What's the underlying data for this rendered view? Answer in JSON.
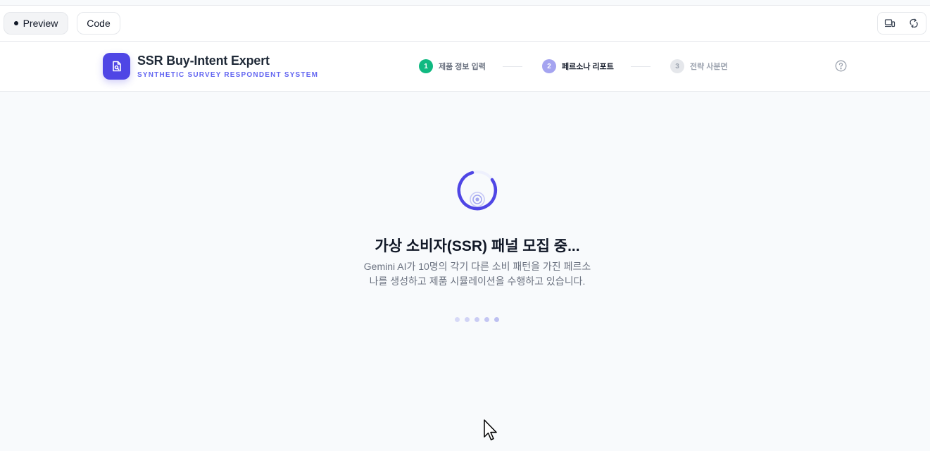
{
  "toolbar": {
    "preview_label": "Preview",
    "code_label": "Code",
    "icons": [
      "devices-icon",
      "refresh-icon"
    ]
  },
  "header": {
    "logo_icon": "document-search-icon",
    "title": "SSR Buy-Intent Expert",
    "subtitle": "SYNTHETIC SURVEY RESPONDENT SYSTEM",
    "help_icon": "help-circle-icon",
    "steps": [
      {
        "number": "1",
        "label": "제품 정보 입력",
        "status": "completed"
      },
      {
        "number": "2",
        "label": "페르소나 리포트",
        "status": "active"
      },
      {
        "number": "3",
        "label": "전략 사분면",
        "status": "upcoming"
      }
    ]
  },
  "loading": {
    "heading": "가상 소비자(SSR) 패널 모집 중...",
    "description_line1": "Gemini AI가 10명의 각기 다른 소비 패턴을 가진 페르소",
    "description_line2": "나를 생성하고 제품 시뮬레이션을 수행하고 있습니다.",
    "dot_colors": [
      "#d7d9f7",
      "#d1d3f5",
      "#caccf4",
      "#c4c6f3",
      "#bdc0f1"
    ]
  },
  "colors": {
    "accent": "#4f46e5",
    "completed": "#10b981",
    "active_step": "#a5a4f0"
  }
}
